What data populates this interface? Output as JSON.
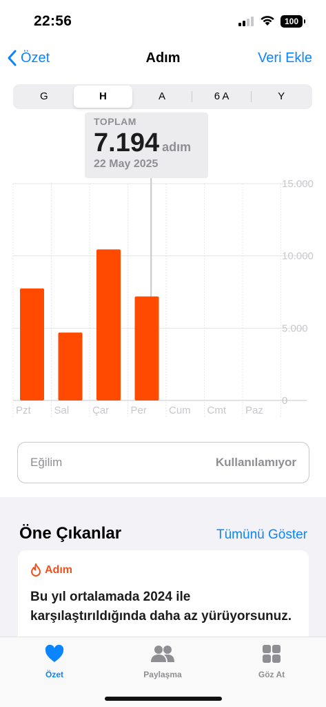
{
  "status_bar": {
    "time": "22:56",
    "battery": "100",
    "icons": [
      "signal-icon",
      "wifi-icon",
      "battery-icon"
    ]
  },
  "nav": {
    "back_label": "Özet",
    "title": "Adım",
    "action_label": "Veri Ekle"
  },
  "segments": [
    {
      "label": "G",
      "active": false
    },
    {
      "label": "H",
      "active": true
    },
    {
      "label": "A",
      "active": false
    },
    {
      "label": "6 A",
      "active": false
    },
    {
      "label": "Y",
      "active": false
    }
  ],
  "callout": {
    "label": "TOPLAM",
    "value": "7.194",
    "unit": "adım",
    "date": "22 May 2025"
  },
  "chart_data": {
    "type": "bar",
    "categories": [
      "Pzt",
      "Sal",
      "Çar",
      "Per",
      "Cum",
      "Cmt",
      "Paz"
    ],
    "values": [
      7750,
      4700,
      10450,
      7194,
      null,
      null,
      null
    ],
    "ylim": [
      0,
      15000
    ],
    "y_ticks": [
      0,
      5000,
      10000,
      15000
    ],
    "y_tick_labels": [
      "0",
      "5.000",
      "10.000",
      "15.000"
    ],
    "selected_index": 3,
    "bar_color": "#ff4a00",
    "grid": true
  },
  "trend": {
    "label": "Eğilim",
    "value": "Kullanılamıyor"
  },
  "highlights": {
    "title": "Öne Çıkanlar",
    "show_all": "Tümünü Göster",
    "card": {
      "icon": "flame-icon",
      "category": "Adım",
      "text": "Bu yıl ortalamada 2024 ile karşılaştırıldığında daha az yürüyorsunuz."
    }
  },
  "tabs": [
    {
      "label": "Özet",
      "icon": "heart-icon",
      "active": true
    },
    {
      "label": "Paylaşma",
      "icon": "people-icon",
      "active": false
    },
    {
      "label": "Göz At",
      "icon": "grid-icon",
      "active": false
    }
  ],
  "colors": {
    "accent": "#0a84ff",
    "bar": "#ff4a00",
    "highlight": "#f2501d"
  }
}
